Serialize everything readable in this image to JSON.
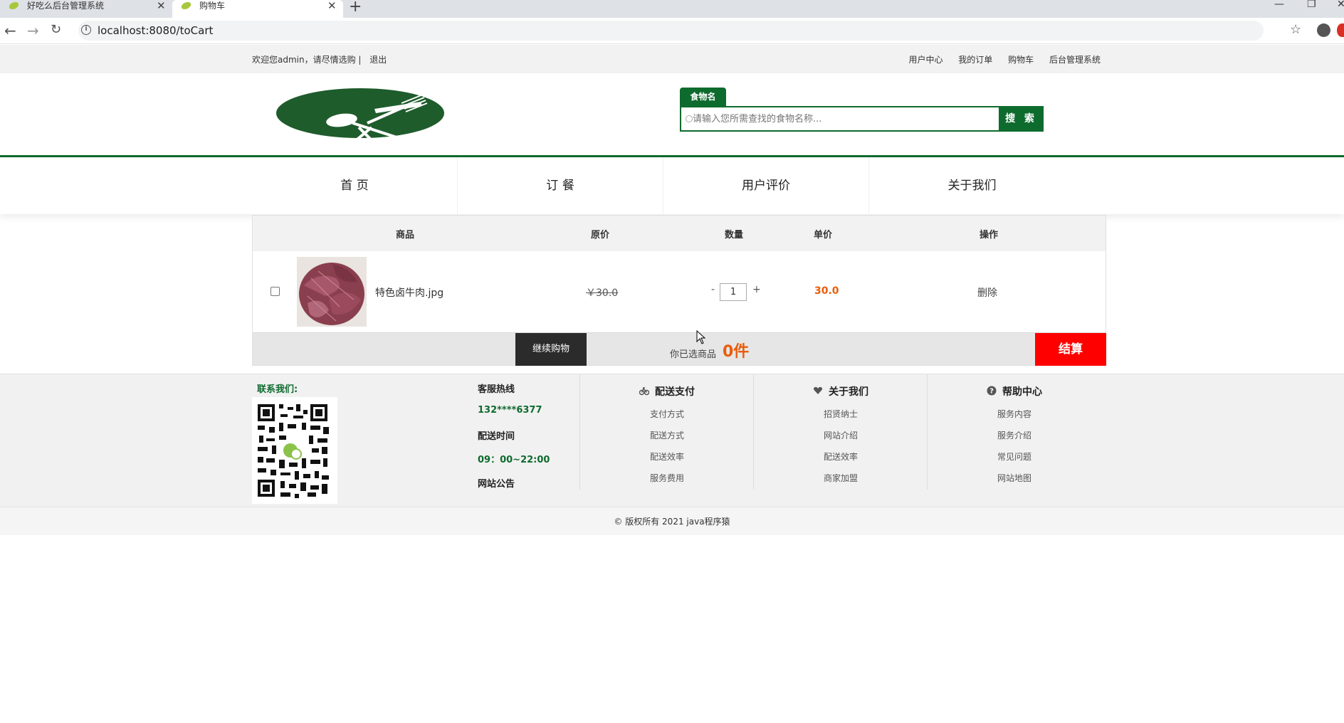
{
  "browser": {
    "tabs": [
      {
        "title": "好吃么后台管理系统",
        "active": false
      },
      {
        "title": "购物车",
        "active": true
      }
    ],
    "url": "localhost:8080/toCart"
  },
  "topbar": {
    "welcome": "欢迎您admin，请尽情选购 |",
    "logout": "退出",
    "links": [
      "用户中心",
      "我的订单",
      "购物车",
      "后台管理系统"
    ]
  },
  "search": {
    "tab_label": "食物名",
    "placeholder": "请输入您所需查找的食物名称...",
    "button": "搜 索"
  },
  "nav": {
    "items": [
      "首 页",
      "订 餐",
      "用户评价",
      "关于我们"
    ]
  },
  "cart": {
    "headers": {
      "product": "商品",
      "original_price": "原价",
      "quantity": "数量",
      "unit_price": "单价",
      "action": "操作"
    },
    "items": [
      {
        "name": "特色卤牛肉.jpg",
        "original_price": "￥30.0",
        "quantity": "1",
        "unit_price": "30.0",
        "action": "删除",
        "checked": false
      }
    ],
    "minus": "-",
    "plus": "+",
    "continue_label": "继续购物",
    "selected_text": "你已选商品",
    "selected_count": "0件",
    "checkout_label": "结算"
  },
  "footer": {
    "contact_label": "联系我们:",
    "hotline_label": "客服热线",
    "hotline_number": "132****6377",
    "delivery_time_label": "配送时间",
    "delivery_time": "09：00~22:00",
    "notice_label": "网站公告",
    "columns": [
      {
        "title": "配送支付",
        "icon": "bicycle-icon",
        "items": [
          "支付方式",
          "配送方式",
          "配送效率",
          "服务费用"
        ]
      },
      {
        "title": "关于我们",
        "icon": "heart-icon",
        "items": [
          "招贤纳士",
          "网站介绍",
          "配送效率",
          "商家加盟"
        ]
      },
      {
        "title": "帮助中心",
        "icon": "question-icon",
        "items": [
          "服务内容",
          "服务介绍",
          "常见问题",
          "网站地图"
        ]
      }
    ],
    "copyright": "© 版权所有 2021   java程序猿"
  },
  "colors": {
    "brand_green": "#0e6b2e",
    "accent_orange": "#e85d0c",
    "checkout_red": "#ff0000"
  }
}
